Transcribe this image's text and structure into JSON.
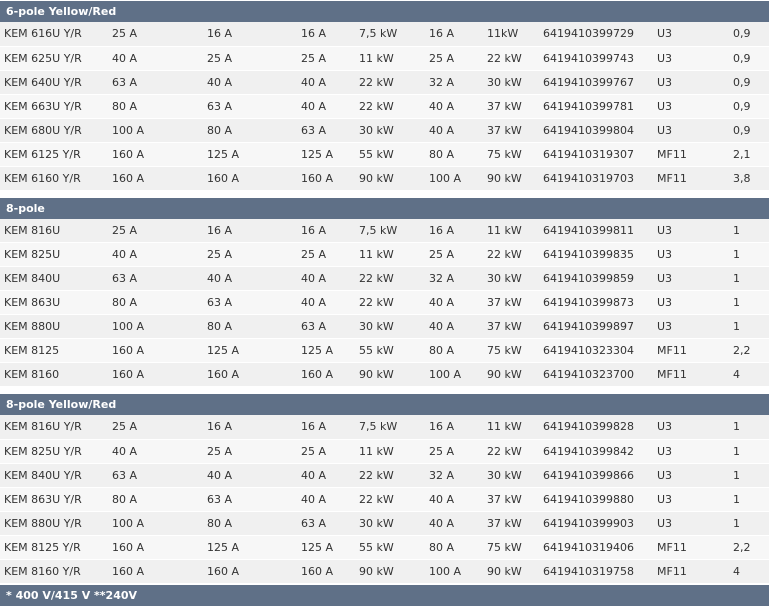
{
  "sections": [
    {
      "title": "6-pole Yellow/Red",
      "rows": [
        [
          "KEM 616U Y/R",
          "25 A",
          "16 A",
          "16 A",
          "7,5 kW",
          "16 A",
          "11kW",
          "6419410399729",
          "U3",
          "0,9"
        ],
        [
          "KEM 625U Y/R",
          "40 A",
          "25 A",
          "25 A",
          "11 kW",
          "25 A",
          "22 kW",
          "6419410399743",
          "U3",
          "0,9"
        ],
        [
          "KEM 640U Y/R",
          "63 A",
          "40 A",
          "40 A",
          "22 kW",
          "32 A",
          "30 kW",
          "6419410399767",
          "U3",
          "0,9"
        ],
        [
          "KEM 663U Y/R",
          "80 A",
          "63 A",
          "40 A",
          "22 kW",
          "40 A",
          "37 kW",
          "6419410399781",
          "U3",
          "0,9"
        ],
        [
          "KEM 680U Y/R",
          "100 A",
          "80 A",
          "63 A",
          "30 kW",
          "40 A",
          "37 kW",
          "6419410399804",
          "U3",
          "0,9"
        ],
        [
          "KEM 6125 Y/R",
          "160 A",
          "125 A",
          "125 A",
          "55 kW",
          "80 A",
          "75 kW",
          "6419410319307",
          "MF11",
          "2,1"
        ],
        [
          "KEM 6160 Y/R",
          "160 A",
          "160 A",
          "160 A",
          "90 kW",
          "100 A",
          "90 kW",
          "6419410319703",
          "MF11",
          "3,8"
        ]
      ]
    },
    {
      "title": "8-pole",
      "rows": [
        [
          "KEM 816U",
          "25 A",
          "16 A",
          "16 A",
          "7,5 kW",
          "16 A",
          "11 kW",
          "6419410399811",
          "U3",
          "1"
        ],
        [
          "KEM 825U",
          "40 A",
          "25 A",
          "25 A",
          "11 kW",
          "25 A",
          "22 kW",
          "6419410399835",
          "U3",
          "1"
        ],
        [
          "KEM 840U",
          "63 A",
          "40 A",
          "40 A",
          "22 kW",
          "32 A",
          "30 kW",
          "6419410399859",
          "U3",
          "1"
        ],
        [
          "KEM 863U",
          "80 A",
          "63 A",
          "40 A",
          "22 kW",
          "40 A",
          "37 kW",
          "6419410399873",
          "U3",
          "1"
        ],
        [
          "KEM 880U",
          "100 A",
          "80 A",
          "63 A",
          "30 kW",
          "40 A",
          "37 kW",
          "6419410399897",
          "U3",
          "1"
        ],
        [
          "KEM 8125",
          "160 A",
          "125 A",
          "125 A",
          "55 kW",
          "80 A",
          "75 kW",
          "6419410323304",
          "MF11",
          "2,2"
        ],
        [
          "KEM 8160",
          "160 A",
          "160 A",
          "160 A",
          "90 kW",
          "100 A",
          "90 kW",
          "6419410323700",
          "MF11",
          "4"
        ]
      ]
    },
    {
      "title": "8-pole Yellow/Red",
      "rows": [
        [
          "KEM 816U Y/R",
          "25 A",
          "16 A",
          "16 A",
          "7,5 kW",
          "16 A",
          "11 kW",
          "6419410399828",
          "U3",
          "1"
        ],
        [
          "KEM 825U Y/R",
          "40 A",
          "25 A",
          "25 A",
          "11 kW",
          "25 A",
          "22 kW",
          "6419410399842",
          "U3",
          "1"
        ],
        [
          "KEM 840U Y/R",
          "63 A",
          "40 A",
          "40 A",
          "22 kW",
          "32 A",
          "30 kW",
          "6419410399866",
          "U3",
          "1"
        ],
        [
          "KEM 863U Y/R",
          "80 A",
          "63 A",
          "40 A",
          "22 kW",
          "40 A",
          "37 kW",
          "6419410399880",
          "U3",
          "1"
        ],
        [
          "KEM 880U Y/R",
          "100 A",
          "80 A",
          "63 A",
          "30 kW",
          "40 A",
          "37 kW",
          "6419410399903",
          "U3",
          "1"
        ],
        [
          "KEM 8125 Y/R",
          "160 A",
          "125 A",
          "125 A",
          "55 kW",
          "80 A",
          "75 kW",
          "6419410319406",
          "MF11",
          "2,2"
        ],
        [
          "KEM 8160 Y/R",
          "160 A",
          "160 A",
          "160 A",
          "90 kW",
          "100 A",
          "90 kW",
          "6419410319758",
          "MF11",
          "4"
        ]
      ]
    }
  ],
  "footer": "* 400 V/415 V **240V",
  "colors": {
    "header_bg": "#5f7087",
    "row_odd": "#f0f0f0",
    "row_even": "#f7f7f7"
  }
}
